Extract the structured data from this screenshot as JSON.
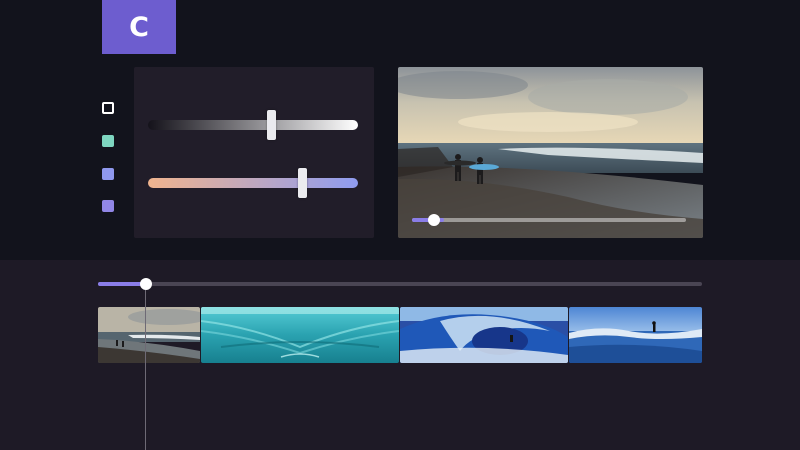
{
  "app": {
    "logo_letter": "C",
    "accent_color": "#6d5dcf"
  },
  "color_swatches": [
    {
      "name": "white-outline",
      "color": "#ffffff"
    },
    {
      "name": "mint",
      "color": "#7ed6c0"
    },
    {
      "name": "periwinkle",
      "color": "#8f98ee"
    },
    {
      "name": "lavender",
      "color": "#9186e6"
    }
  ],
  "adjustments": {
    "slider_1": {
      "gradient": [
        "#14121a",
        "#ffffff"
      ],
      "level": 0.57
    },
    "slider_2": {
      "gradient": [
        "#f0b48e",
        "#8f9cf0"
      ],
      "level": 0.73
    }
  },
  "preview": {
    "scene": "surfers-beach-sunset",
    "playback_progress": 0.07,
    "progress_color": "#8a7de8"
  },
  "timeline": {
    "playhead_progress": 0.08,
    "progress_color": "#8a7de8",
    "clips": [
      {
        "scene": "beach-sunset-surfers"
      },
      {
        "scene": "turquoise-wave-mirror"
      },
      {
        "scene": "barrel-wave-surfer"
      },
      {
        "scene": "surfer-blue-sky"
      }
    ]
  }
}
